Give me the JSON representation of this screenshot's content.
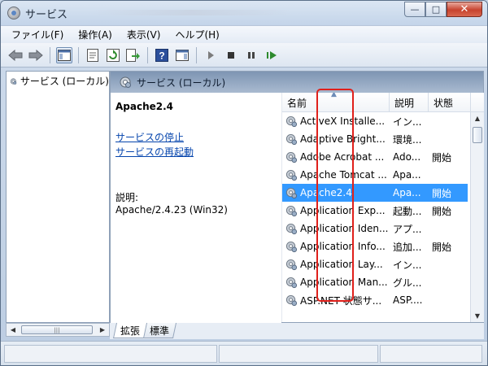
{
  "window": {
    "title": "サービス",
    "minimize": "—",
    "maximize": "□",
    "close": "✕"
  },
  "menu": [
    "ファイル(F)",
    "操作(A)",
    "表示(V)",
    "ヘルプ(H)"
  ],
  "toolbar": {
    "icons": [
      "back-icon",
      "forward-icon",
      "console-tree-icon",
      "properties-icon",
      "refresh-icon",
      "export-icon",
      "help-icon",
      "action-pane-icon",
      "play-icon",
      "stop-icon",
      "pause-icon",
      "restart-icon"
    ]
  },
  "left_pane": {
    "tree_item": "サービス (ローカル)"
  },
  "right_pane": {
    "header": "サービス (ローカル)",
    "selected_service": "Apache2.4",
    "stop_link": "サービスの停止",
    "restart_link": "サービスの再起動",
    "description_label": "説明:",
    "description_value": "Apache/2.4.23 (Win32)"
  },
  "list": {
    "columns": [
      "名前",
      "説明",
      "状態"
    ],
    "rows": [
      {
        "name": "ActiveX Installe...",
        "desc": "イン...",
        "status": ""
      },
      {
        "name": "Adaptive Bright...",
        "desc": "環境...",
        "status": ""
      },
      {
        "name": "Adobe Acrobat ...",
        "desc": "Ado...",
        "status": "開始"
      },
      {
        "name": "Apache Tomcat ...",
        "desc": "Apa...",
        "status": ""
      },
      {
        "name": "Apache2.4",
        "desc": "Apa...",
        "status": "開始",
        "selected": true
      },
      {
        "name": "Application Exp...",
        "desc": "起動...",
        "status": "開始"
      },
      {
        "name": "Application Iden...",
        "desc": "アプ...",
        "status": ""
      },
      {
        "name": "Application Info...",
        "desc": "追加...",
        "status": "開始"
      },
      {
        "name": "Application Lay...",
        "desc": "イン...",
        "status": ""
      },
      {
        "name": "Application Man...",
        "desc": "グル...",
        "status": ""
      },
      {
        "name": "ASP.NET 状態サ...",
        "desc": "ASP....",
        "status": ""
      }
    ]
  },
  "tabs": [
    "拡張",
    "標準"
  ],
  "colors": {
    "selection": "#3399ff",
    "highlight": "#e0201b",
    "link": "#0645ad"
  }
}
